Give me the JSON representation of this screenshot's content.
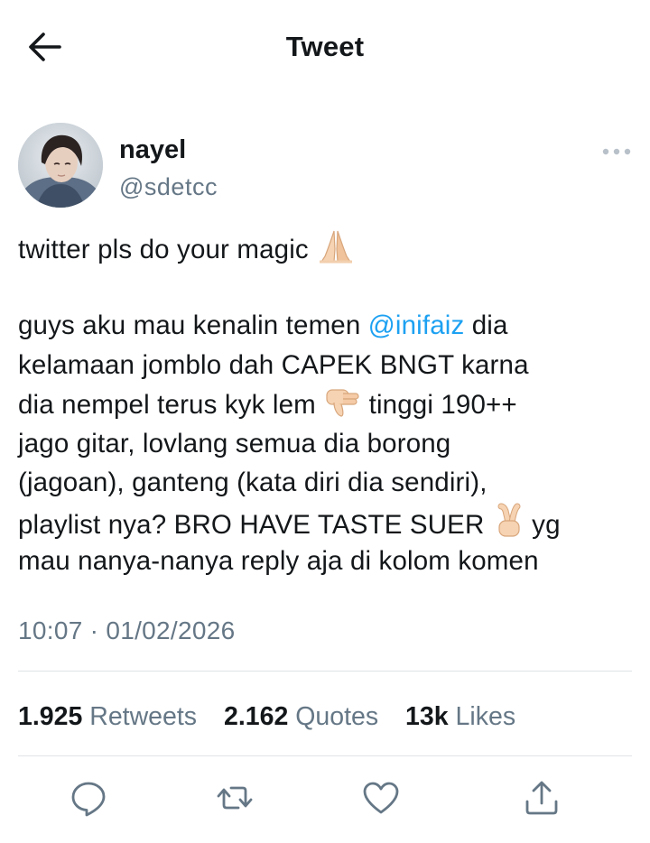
{
  "header": {
    "title": "Tweet",
    "back_icon": "arrow-left-icon"
  },
  "author": {
    "display_name": "nayel",
    "handle": "@sdetcc"
  },
  "tweet": {
    "line1_text": "twitter pls do your magic",
    "line1_emoji": "folded-hands-emoji",
    "line2_pre": "guys aku mau kenalin temen ",
    "line2_mention": "@inifaiz",
    "line2_post": " dia",
    "line3": "kelamaan jomblo dah CAPEK BNGT karna",
    "line4_pre": "dia nempel terus kyk lem",
    "line4_emoji": "thumbs-down-emoji",
    "line4_post": "tinggi 190++",
    "line5": "jago gitar, lovlang semua dia borong",
    "line6": "(jagoan), ganteng (kata diri dia sendiri),",
    "line7_pre": "playlist nya? BRO HAVE TASTE SUER",
    "line7_emoji": "victory-hand-emoji",
    "line7_post": "yg",
    "line8": "mau nanya-nanya reply aja di kolom komen"
  },
  "timestamp": "10:07 · 01/02/2026",
  "stats": {
    "retweets_count": "1.925",
    "retweets_label": "Retweets",
    "quotes_count": "2.162",
    "quotes_label": "Quotes",
    "likes_count": "13k",
    "likes_label": "Likes"
  },
  "actions": [
    "reply-icon",
    "retweet-icon",
    "like-icon",
    "share-icon"
  ],
  "colors": {
    "link": "#1da1f2",
    "secondary_text": "#657786",
    "primary_text": "#14171a",
    "divider": "#dfe3e6"
  }
}
